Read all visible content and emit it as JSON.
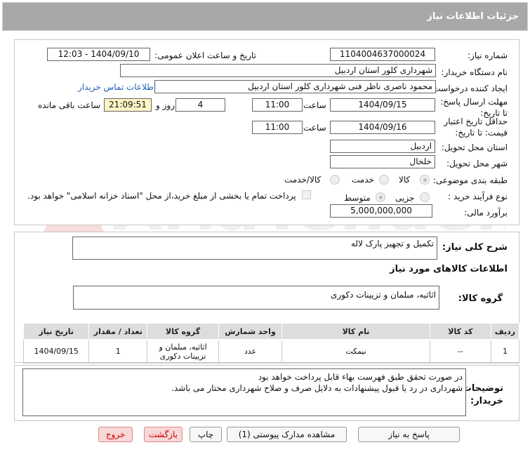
{
  "header": {
    "title": "جزئیات اطلاعات نیاز"
  },
  "form": {
    "need_number_label": "شماره نیاز:",
    "need_number": "1104004637000024",
    "announce_label": "تاریخ و ساعت اعلان عمومی:",
    "announce_value": "1404/09/10 - 12:03",
    "buyer_label": "نام دستگاه خریدار:",
    "buyer_value": "شهرداری کلور استان اردبیل",
    "creator_label": "ایجاد کننده درخواست:",
    "creator_value": "محمود  ناصری  ناظر فنی  شهرداری کلور استان اردبیل",
    "contact_link": "اطلاعات تماس خریدار",
    "deadline_label": "مهلت ارسال پاسخ: تا تاریخ:",
    "deadline_date": "1404/09/15",
    "time_label": "ساعت",
    "deadline_time": "11:00",
    "days_value": "4",
    "days_label": "روز و",
    "remaining_time": "21:09:51",
    "remaining_label": "ساعت باقی مانده",
    "validity_label": "حداقل تاریخ اعتبار قیمت: تا تاریخ:",
    "validity_date": "1404/09/16",
    "validity_time": "11:00",
    "province_label": "استان محل تحویل:",
    "province_value": "اردبیل",
    "city_label": "شهر محل تحویل:",
    "city_value": "خلخال",
    "category_label": "طبقه بندی موضوعی:",
    "category_options": [
      "کالا",
      "خدمت",
      "کالا/خدمت"
    ],
    "process_label": "نوع فرآیند خرید :",
    "process_options": [
      "جزیی",
      "متوسط"
    ],
    "payment_note": "پرداخت تمام یا بخشی از مبلغ خرید،از محل \"اسناد خزانه اسلامی\" خواهد بود.",
    "budget_label": "برآورد مالی:",
    "budget_value": "5,000,000,000"
  },
  "summary": {
    "label": "شرح کلی نیاز:",
    "value": "تکمیل و تجهیز پارک لاله",
    "goods_info_title": "اطلاعات کالاهای مورد نیاز",
    "group_label": "گروه کالا:",
    "group_value": "اثاثیه، مبلمان و تزیینات دکوری"
  },
  "table": {
    "headers": [
      "ردیف",
      "کد کالا",
      "نام کالا",
      "واحد شمارش",
      "گروه کالا",
      "تعداد / مقدار",
      "تاریخ نیاز"
    ],
    "rows": [
      [
        "1",
        "--",
        "نیمکت",
        "عدد",
        "اثاثیه، مبلمان و تزیینات دکوری",
        "1",
        "1404/09/15"
      ]
    ]
  },
  "notes": {
    "label": "توضیحات خریدار:",
    "line1": "در صورت تحقق طبق فهرست بهاء قابل پرداخت خواهد بود",
    "line2": "شهرداری در رد یا قبول پیشنهادات به دلایل  صرف و صلاح شهرداری مختار می باشد."
  },
  "buttons": {
    "reply": "پاسخ به نیاز",
    "attachments": "مشاهده مدارک پیوستی (1)",
    "print": "چاپ",
    "back": "بازگشت",
    "exit": "خروج"
  },
  "watermark_text": "AriaTender.neT",
  "colors": {
    "title_bar": "#a8a8a8",
    "link": "#1d5fb4",
    "remaining_bg": "#fdf5c4",
    "danger": "#c00000"
  }
}
